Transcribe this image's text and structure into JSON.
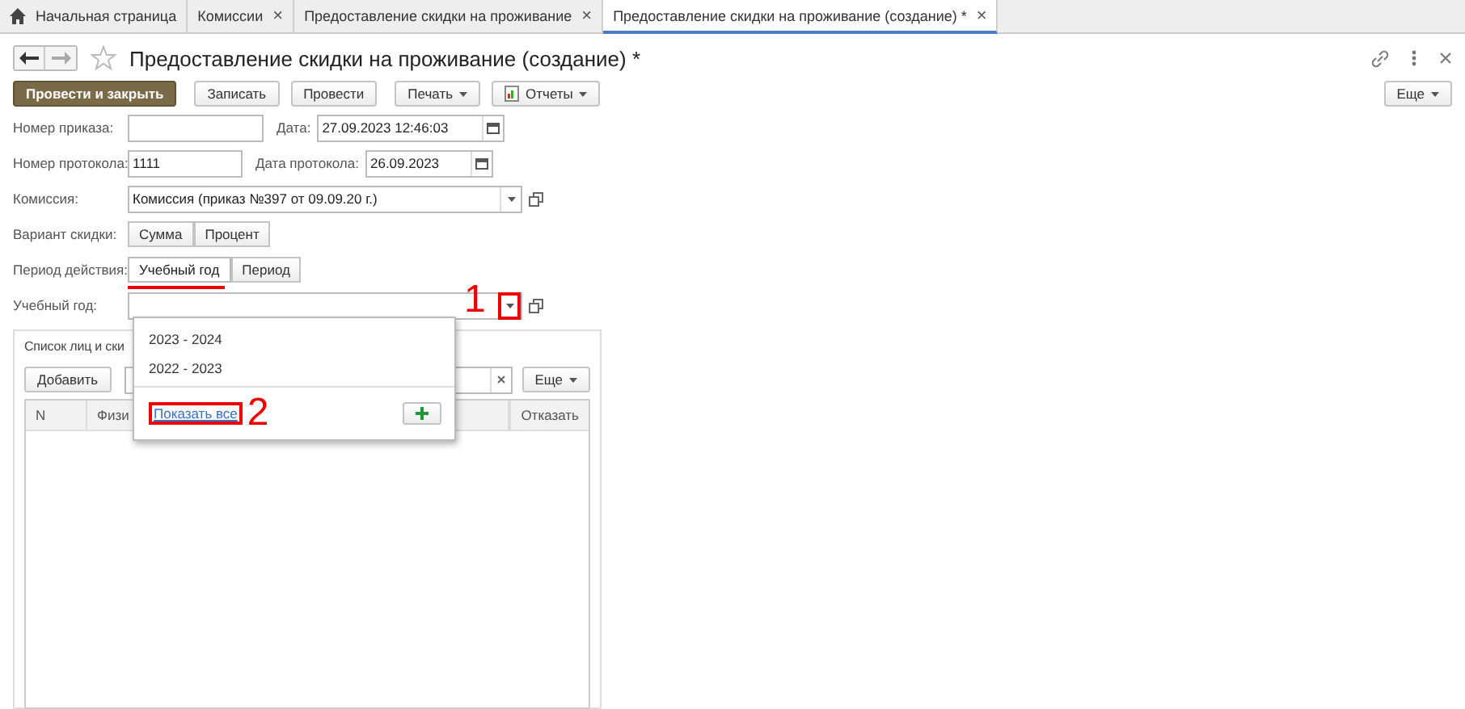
{
  "tabs": [
    {
      "label": "Начальная страница",
      "kind": "home",
      "selected": false
    },
    {
      "label": "Комиссии",
      "kind": "doc",
      "selected": false,
      "close": "×"
    },
    {
      "label": "Предоставление скидки на проживание",
      "kind": "doc",
      "selected": false,
      "close": "×"
    },
    {
      "label": "Предоставление скидки на проживание (создание) *",
      "kind": "doc",
      "selected": true,
      "close": "×"
    }
  ],
  "form": {
    "title": "Предоставление скидки на проживание (создание) *",
    "toolbar": [
      {
        "label": "Провести и закрыть",
        "kind": "primary"
      },
      {
        "label": "Записать",
        "kind": "plain"
      },
      {
        "label": "Провести",
        "kind": "plain"
      },
      {
        "label": "Печать",
        "kind": "menu"
      },
      {
        "label": "Отчеты",
        "kind": "report"
      }
    ],
    "more_button": "Еще",
    "rows": [
      {
        "label": "Номер приказа:",
        "kind": "pair",
        "value": "",
        "label2": "Дата:",
        "value2": "27.09.2023 12:46:03"
      },
      {
        "label": "Номер протокола:",
        "kind": "pair2",
        "value": "1111",
        "label2": "Дата протокола:",
        "value2": "26.09.2023"
      },
      {
        "label": "Комиссия:",
        "kind": "select",
        "value": "Комиссия (приказ №397 от 09.09.20 г.)"
      },
      {
        "label": "Вариант скидки:",
        "kind": "switch",
        "options": [
          {
            "label": "Сумма",
            "selected": false
          },
          {
            "label": "Процент",
            "selected": false
          }
        ]
      },
      {
        "label": "Период действия:",
        "kind": "switch",
        "options": [
          {
            "label": "Учебный год",
            "selected": true
          },
          {
            "label": "Период",
            "selected": false
          }
        ]
      },
      {
        "label": "Учебный год:",
        "kind": "select",
        "value": ""
      }
    ],
    "group": {
      "title": "Список лиц и ски",
      "add_button": "Добавить",
      "more_button": "Еще",
      "columns": [
        "N",
        "Физи",
        "Отказать"
      ]
    },
    "dropdown": {
      "items": [
        "2023 - 2024",
        "2022 - 2023"
      ],
      "show_all": "Показать все"
    },
    "annotations": [
      "1",
      "2"
    ]
  }
}
